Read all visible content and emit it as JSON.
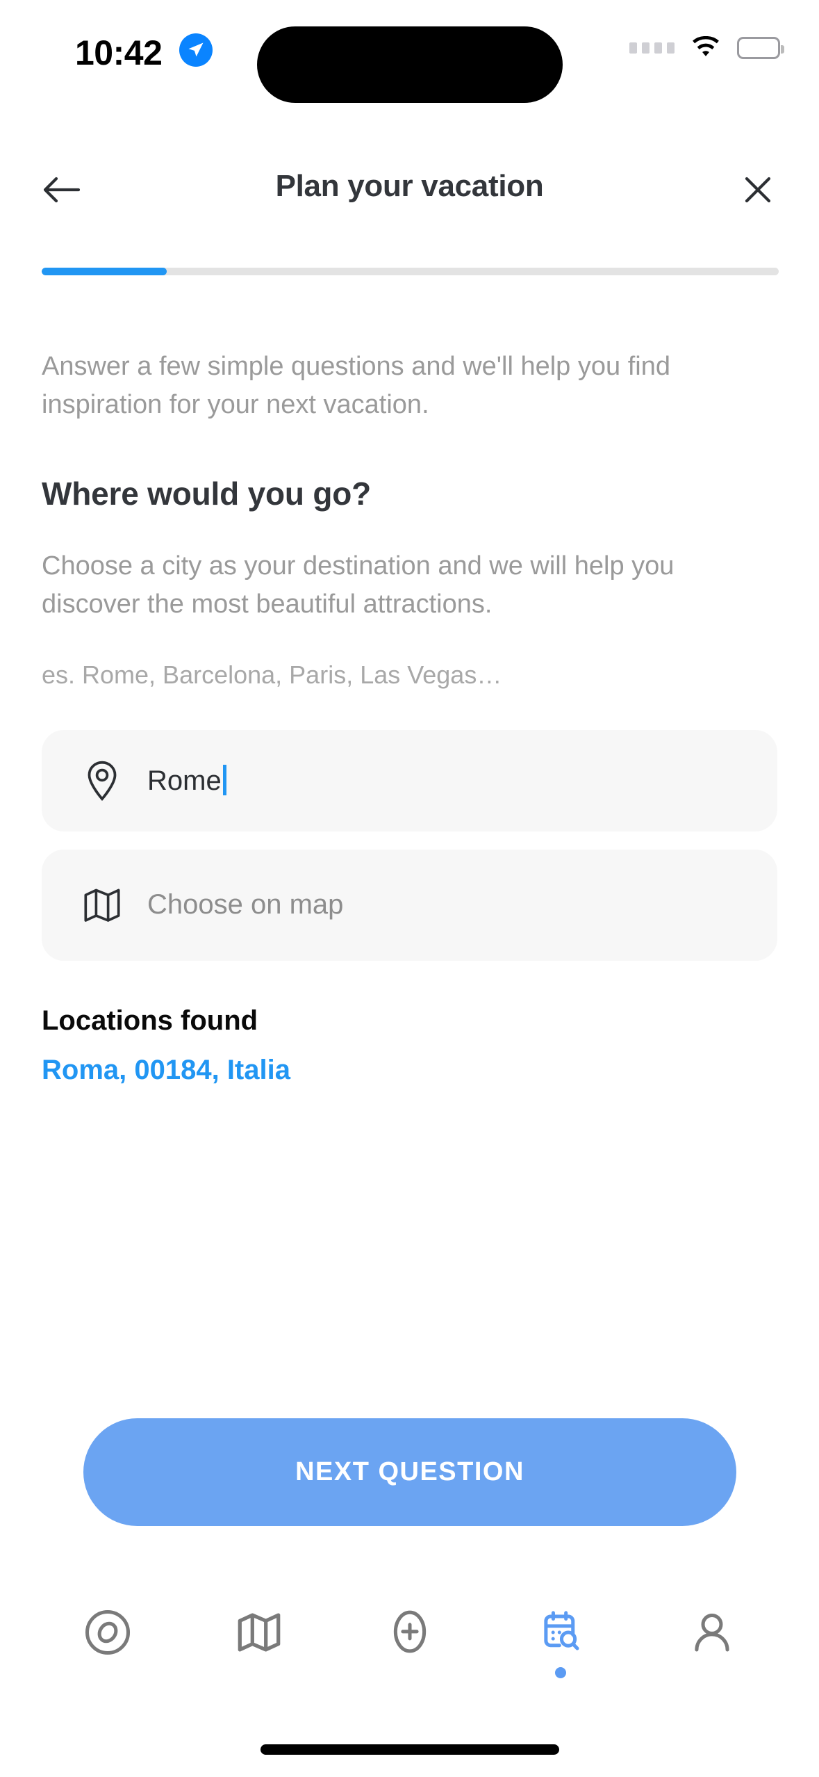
{
  "status_bar": {
    "time": "10:42",
    "location_icon": "location-arrow-icon",
    "signal_icon": "signal-dots-icon",
    "wifi_icon": "wifi-icon",
    "battery_icon": "battery-full-icon"
  },
  "header": {
    "back_icon": "arrow-left-icon",
    "title": "Plan your vacation",
    "close_icon": "close-icon"
  },
  "progress": {
    "percent": 17,
    "fill_color": "#2196f3",
    "track_color": "#e3e3e3"
  },
  "main": {
    "intro": "Answer a few simple questions and we'll help you find inspiration for your next vacation.",
    "question_title": "Where would you go?",
    "question_desc": "Choose a city as your destination and we will help you discover the most beautiful attractions.",
    "examples_hint": "es. Rome, Barcelona, Paris, Las Vegas…",
    "destination_field": {
      "icon": "map-pin-icon",
      "value": "Rome",
      "placeholder": "es. Rome, Barcelona, Paris, Las Vegas…"
    },
    "choose_on_map": {
      "icon": "map-icon",
      "label": "Choose on map"
    },
    "results": {
      "title": "Locations found",
      "items": [
        {
          "label": "Roma, 00184, Italia",
          "color": "#2196f3"
        }
      ]
    }
  },
  "cta": {
    "label": "NEXT QUESTION",
    "color": "#6ba4f2",
    "text_color": "#ffffff"
  },
  "tabbar": {
    "active_color": "#5b9bf3",
    "inactive_color": "#7a7a7a",
    "items": [
      {
        "name": "explore",
        "icon": "compass-icon",
        "active": false
      },
      {
        "name": "map",
        "icon": "map-icon",
        "active": false
      },
      {
        "name": "add",
        "icon": "plus-pin-icon",
        "active": false
      },
      {
        "name": "trips",
        "icon": "calendar-search-icon",
        "active": true
      },
      {
        "name": "profile",
        "icon": "person-icon",
        "active": false
      }
    ]
  }
}
